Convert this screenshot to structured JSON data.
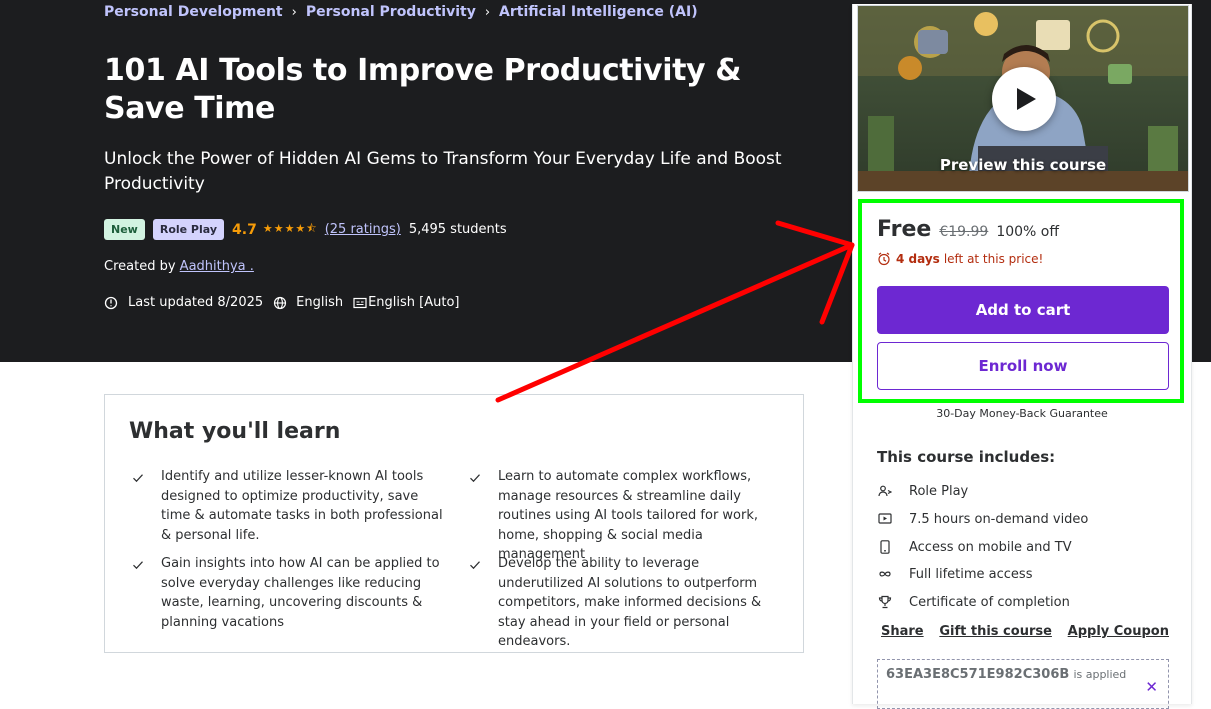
{
  "breadcrumb": [
    "Personal Development",
    "Personal Productivity",
    "Artificial Intelligence (AI)"
  ],
  "course": {
    "title": "101 AI Tools to Improve Productivity & Save Time",
    "subtitle": "Unlock the Power of Hidden AI Gems to Transform Your Everyday Life and Boost Productivity",
    "badge_new": "New",
    "badge_role": "Role Play",
    "rating": "4.7",
    "rating_stars": 4.5,
    "ratings_count": "(25 ratings)",
    "students": "5,495 students",
    "created_by_label": "Created by",
    "instructor": "Aadhithya .",
    "last_updated": "Last updated 8/2025",
    "language": "English",
    "captions": "English [Auto]"
  },
  "learn": {
    "title": "What you'll learn",
    "items": [
      "Identify and utilize lesser-known AI tools designed to optimize productivity, save time & automate tasks in both professional & personal life.",
      "Learn to automate complex workflows, manage resources & streamline daily routines using AI tools tailored for work, home, shopping & social media management",
      "Gain insights into how AI can be applied to solve everyday challenges like reducing waste, learning, uncovering discounts & planning vacations",
      "Develop the ability to leverage underutilized AI solutions to outperform competitors, make informed decisions & stay ahead in your field or personal endeavors."
    ]
  },
  "sidebar": {
    "preview_label": "Preview this course",
    "price": "Free",
    "old_price": "€19.99",
    "discount": "100% off",
    "timer_bold": "4 days",
    "timer_rest": "left at this price!",
    "add_to_cart": "Add to cart",
    "enroll_now": "Enroll now",
    "guarantee": "30-Day Money-Back Guarantee",
    "includes_title": "This course includes:",
    "includes": [
      {
        "icon": "role-play-icon",
        "label": "Role Play"
      },
      {
        "icon": "video-icon",
        "label": "7.5 hours on-demand video"
      },
      {
        "icon": "mobile-icon",
        "label": "Access on mobile and TV"
      },
      {
        "icon": "infinity-icon",
        "label": "Full lifetime access"
      },
      {
        "icon": "trophy-icon",
        "label": "Certificate of completion"
      }
    ],
    "links": [
      "Share",
      "Gift this course",
      "Apply Coupon"
    ],
    "coupon_code": "63EA3E8C571E982C306B",
    "coupon_applied": "is applied"
  },
  "colors": {
    "hero_bg": "#1c1d1f",
    "accent_purple": "#6d28d2",
    "link_lavender": "#c0c4fc",
    "rating_orange": "#f69c08",
    "timer_red": "#b32d0f",
    "highlight_green": "#00ff00",
    "arrow_red": "#ff0000"
  }
}
